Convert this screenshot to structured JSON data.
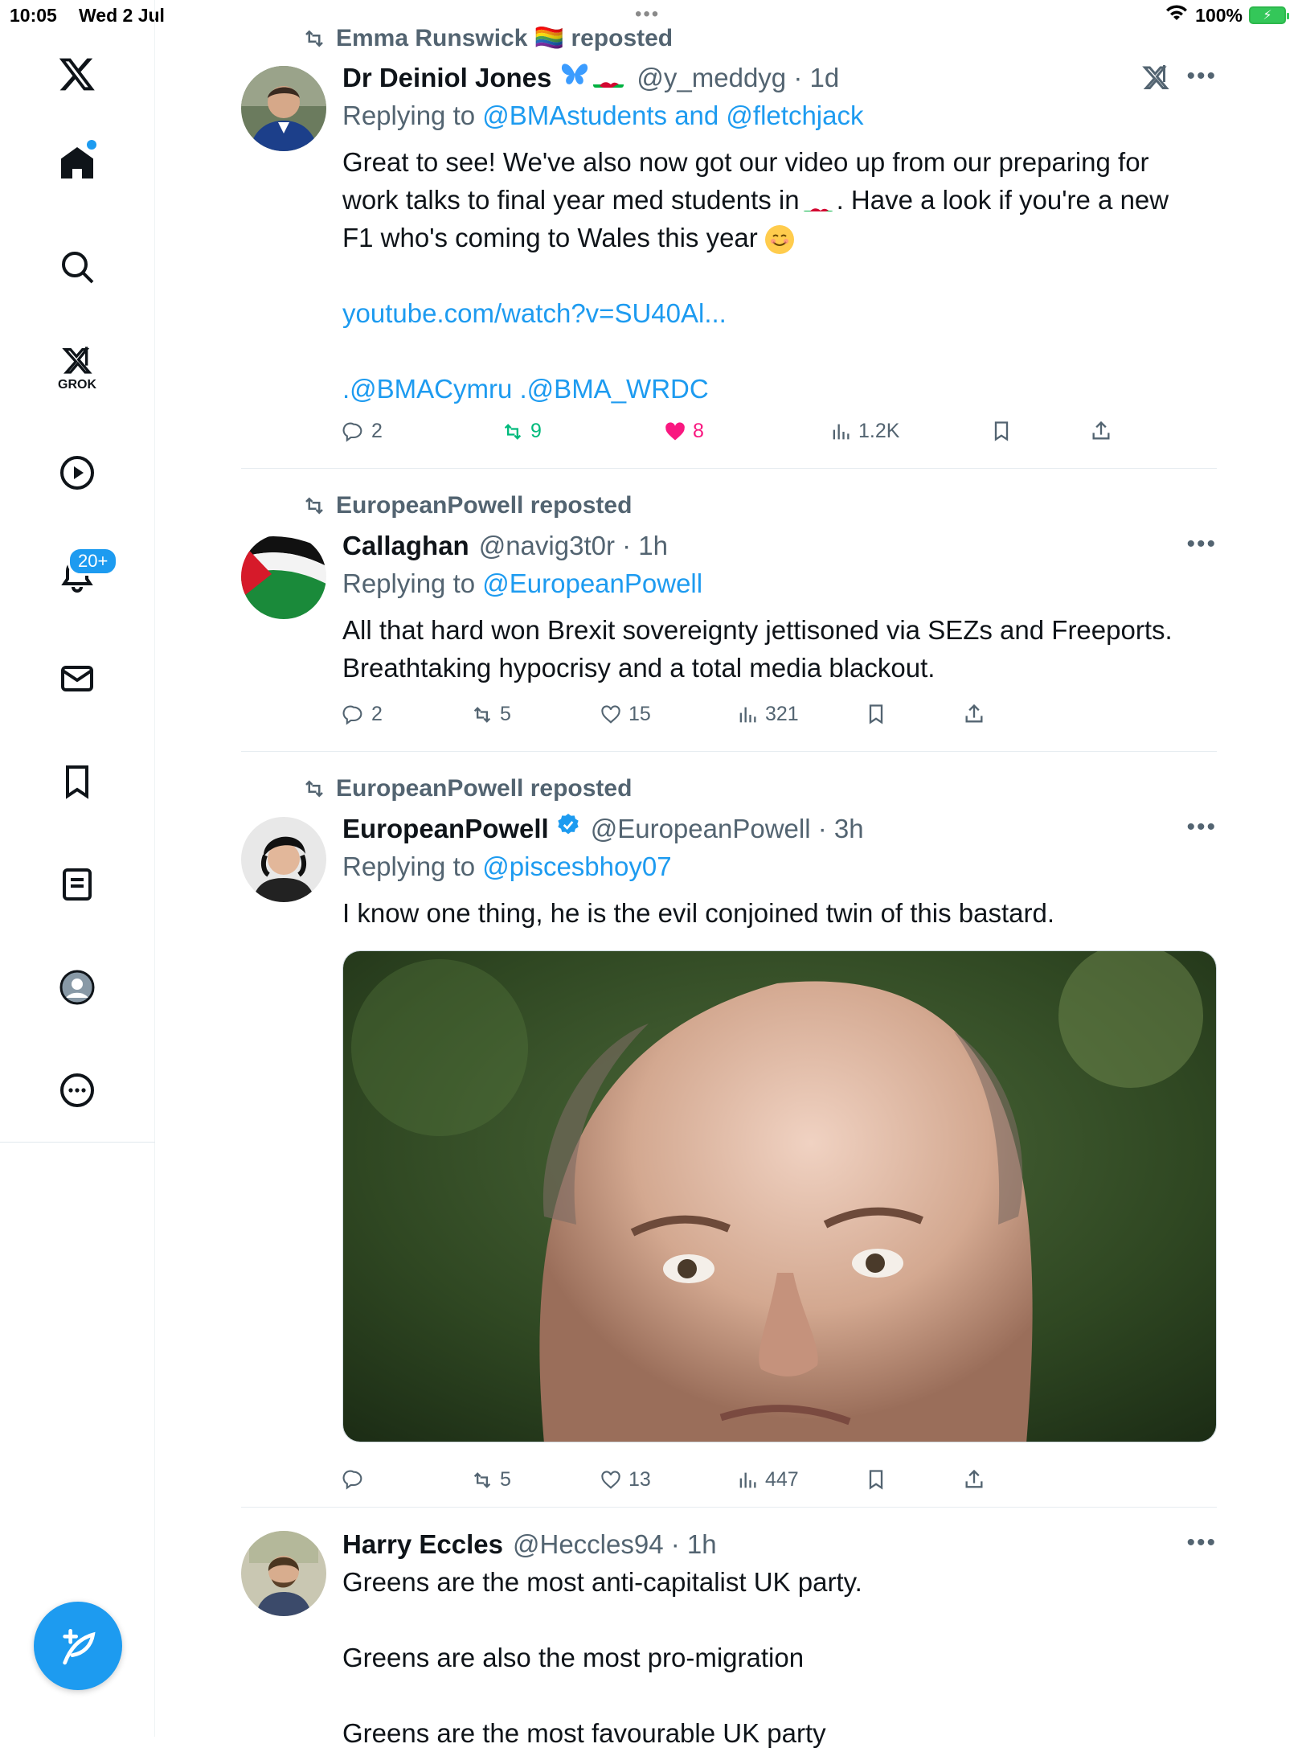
{
  "status_bar": {
    "time": "10:05",
    "date": "Wed 2 Jul",
    "battery": "100%"
  },
  "sidebar": {
    "grok_label": "GROK",
    "notifications_badge": "20+"
  },
  "tweets": [
    {
      "repost_by": "Emma Runswick 🏳️‍🌈 reposted",
      "name": "Dr Deiniol Jones",
      "handle": "@y_meddyg · 1d",
      "replying_prefix": "Replying to ",
      "replying_to": "@BMAstudents and @fletchjack",
      "text_1": "Great to see! We've also now got our video up from our preparing for",
      "text_2a": "work talks to final year med students in",
      "text_2b": ". Have a look if you're a new",
      "text_3": "F1 who's coming to Wales this year",
      "link": "youtube.com/watch?v=SU40Al...",
      "mentions": ".@BMACymru .@BMA_WRDC",
      "replies": "2",
      "reposts": "9",
      "likes": "8",
      "views": "1.2K"
    },
    {
      "repost_by": "EuropeanPowell reposted",
      "name": "Callaghan",
      "handle": "@navig3t0r · 1h",
      "replying_prefix": "Replying to ",
      "replying_to": "@EuropeanPowell",
      "text_1": "All that hard won Brexit sovereignty jettisoned via SEZs and Freeports.",
      "text_2": "Breathtaking hypocrisy and a total media blackout.",
      "replies": "2",
      "reposts": "5",
      "likes": "15",
      "views": "321"
    },
    {
      "repost_by": "EuropeanPowell reposted",
      "name": "EuropeanPowell",
      "handle": "@EuropeanPowell · 3h",
      "replying_prefix": "Replying to ",
      "replying_to": "@piscesbhoy07",
      "text_1": "I know one thing, he is the evil conjoined twin of this bastard.",
      "replies": "",
      "reposts": "5",
      "likes": "13",
      "views": "447"
    },
    {
      "name": "Harry Eccles",
      "handle": "@Heccles94 · 1h",
      "text_1": "Greens are the most anti-capitalist UK party.",
      "text_2": "Greens are also the most pro-migration",
      "text_3": "Greens are the most favourable UK party"
    }
  ],
  "colors": {
    "accent": "#1d9bf0",
    "repost_green": "#00ba7c",
    "like_pink": "#f91880",
    "muted": "#536471"
  }
}
